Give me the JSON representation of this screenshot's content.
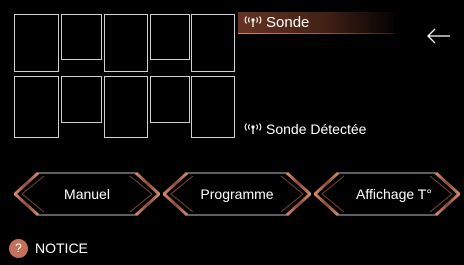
{
  "sonde": {
    "title": "Sonde",
    "detected_label": "Sonde Détectée",
    "icon": "signal-wave-icon"
  },
  "navigation": {
    "back_icon": "back-arrow-icon"
  },
  "zones": {
    "count": 10
  },
  "modes": [
    {
      "label": "Manuel"
    },
    {
      "label": "Programme"
    },
    {
      "label": "Affichage T°"
    }
  ],
  "notice": {
    "badge": "?",
    "label": "NOTICE"
  },
  "colors": {
    "background": "#000000",
    "accent": "#c4715a",
    "outline": "#cfcfcf"
  }
}
